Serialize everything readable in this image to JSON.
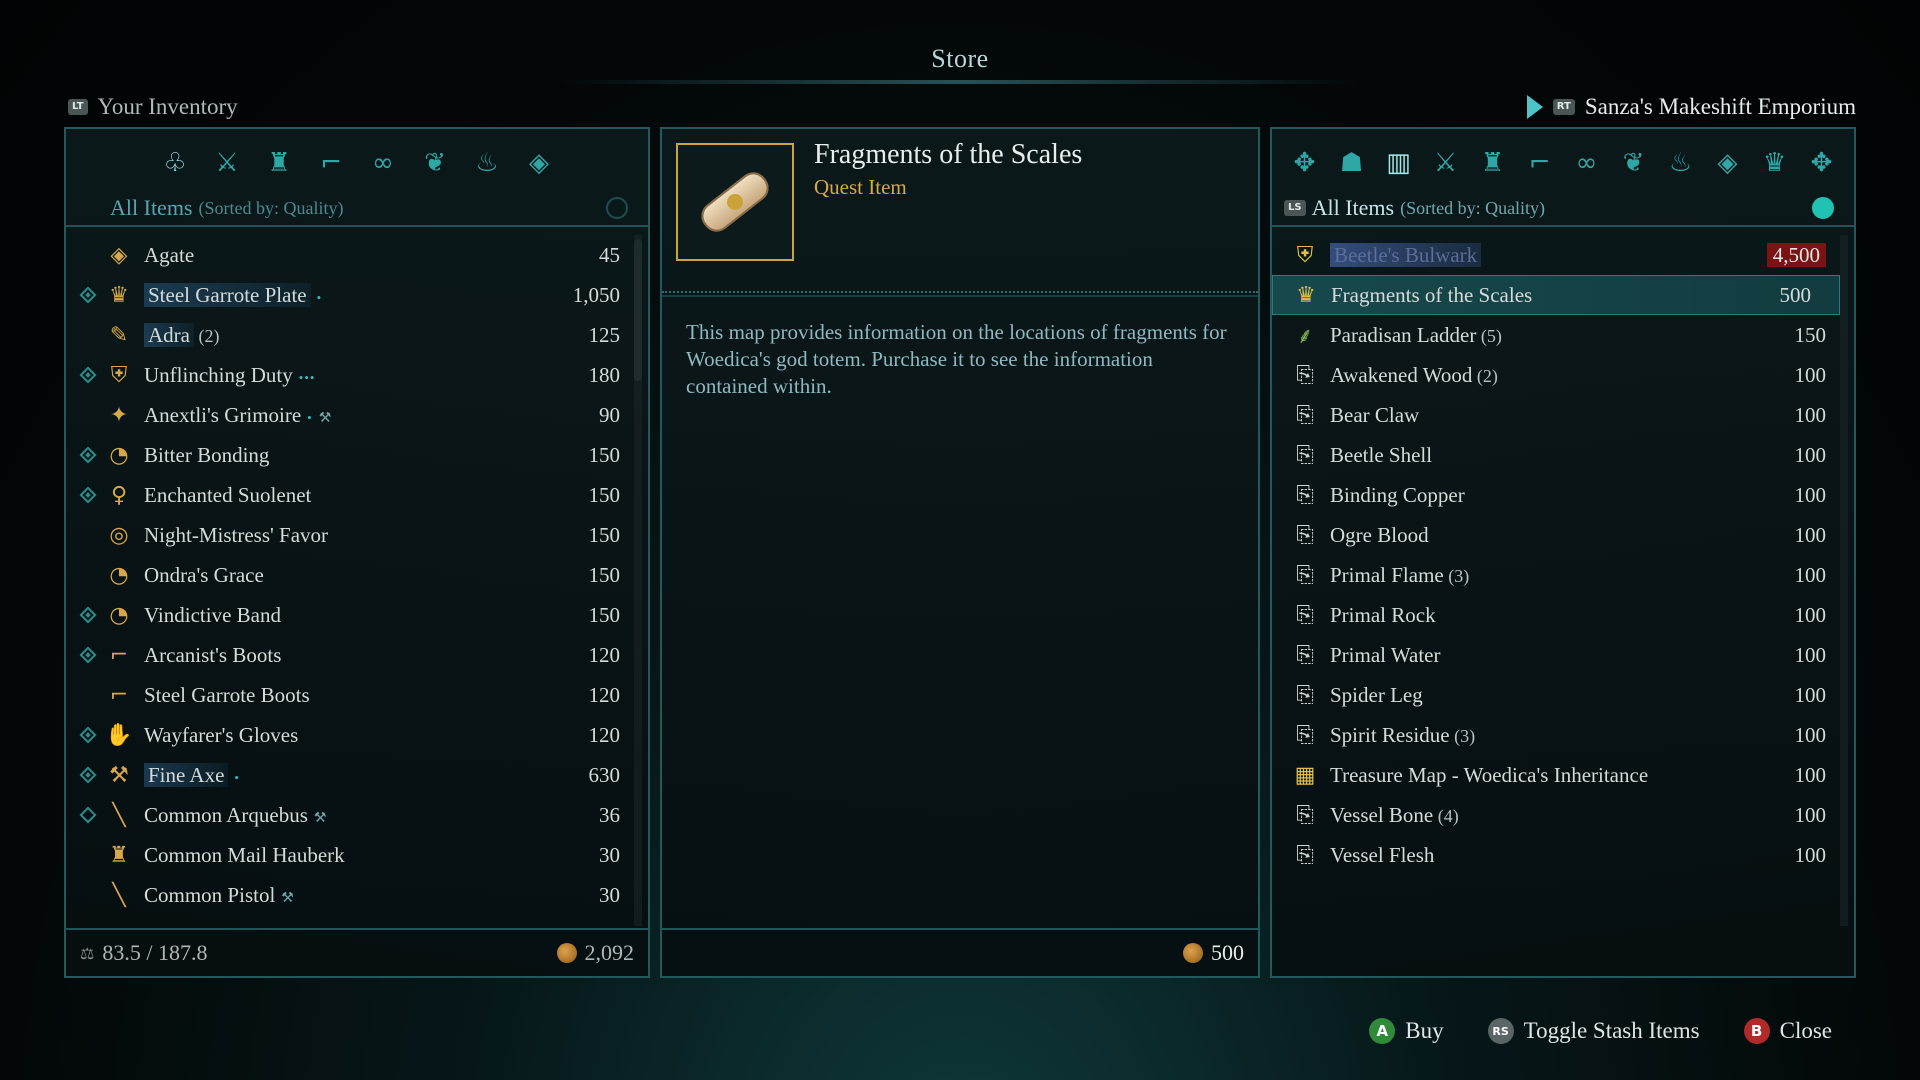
{
  "title": "Store",
  "inventory": {
    "button_hint": "LT",
    "label": "Your Inventory",
    "filter_label": "All Items",
    "filter_sort": "(Sorted by: Quality)",
    "tabs": [
      "pouch-icon",
      "weapons-icon",
      "armor-icon",
      "boots-icon",
      "trinkets-icon",
      "ingredients-icon",
      "lamp-icon",
      "gem-icon"
    ],
    "items": [
      {
        "name": "Agate",
        "count": "",
        "price": "45",
        "pinned": false,
        "icon": "◈"
      },
      {
        "name": "Steel Garrote Plate",
        "count": "",
        "price": "1,050",
        "pinned": true,
        "icon": "♛",
        "ench": "•",
        "highlight": true
      },
      {
        "name": "Adra",
        "count": "(2)",
        "price": "125",
        "pinned": false,
        "icon": "✎",
        "highlight": true
      },
      {
        "name": "Unflinching Duty",
        "count": "",
        "price": "180",
        "pinned": true,
        "icon": "⛨",
        "ench": "•••"
      },
      {
        "name": "Anextli's Grimoire",
        "count": "",
        "price": "90",
        "pinned": false,
        "icon": "✦",
        "ench": "•",
        "tag": "⚒"
      },
      {
        "name": "Bitter Bonding",
        "count": "",
        "price": "150",
        "pinned": true,
        "icon": "◔"
      },
      {
        "name": "Enchanted Suolenet",
        "count": "",
        "price": "150",
        "pinned": true,
        "icon": "♀"
      },
      {
        "name": "Night-Mistress' Favor",
        "count": "",
        "price": "150",
        "pinned": false,
        "icon": "◎"
      },
      {
        "name": "Ondra's Grace",
        "count": "",
        "price": "150",
        "pinned": false,
        "icon": "◔"
      },
      {
        "name": "Vindictive Band",
        "count": "",
        "price": "150",
        "pinned": true,
        "icon": "◔"
      },
      {
        "name": "Arcanist's Boots",
        "count": "",
        "price": "120",
        "pinned": true,
        "icon": "⌐"
      },
      {
        "name": "Steel Garrote Boots",
        "count": "",
        "price": "120",
        "pinned": false,
        "icon": "⌐"
      },
      {
        "name": "Wayfarer's Gloves",
        "count": "",
        "price": "120",
        "pinned": true,
        "icon": "✋"
      },
      {
        "name": "Fine Axe",
        "count": "",
        "price": "630",
        "pinned": true,
        "icon": "⚒",
        "ench": "•",
        "highlight": true
      },
      {
        "name": "Common Arquebus",
        "count": "",
        "price": "36",
        "pinned": true,
        "hollow": true,
        "icon": "╲",
        "tag": "⚒"
      },
      {
        "name": "Common Mail Hauberk",
        "count": "",
        "price": "30",
        "pinned": false,
        "icon": "♜"
      },
      {
        "name": "Common Pistol",
        "count": "",
        "price": "30",
        "pinned": false,
        "icon": "╲",
        "tag": "⚒"
      }
    ],
    "weight": "83.5 / 187.8",
    "gold": "2,092"
  },
  "detail": {
    "name": "Fragments of the Scales",
    "type": "Quest Item",
    "description": "This map provides information on the locations of fragments for Woedica's god totem. Purchase it to see the information contained within.",
    "price": "500"
  },
  "vendor": {
    "button_hint": "RT",
    "label": "Sanza's Makeshift Emporium",
    "filter_hint": "LS",
    "filter_label": "All Items",
    "filter_sort": "(Sorted by: Quality)",
    "tabs": [
      "prev-icon",
      "helmet-icon",
      "chest-icon",
      "weapons-icon",
      "armor-icon",
      "boots-icon",
      "trinkets-icon",
      "ingredients-icon",
      "lamp-icon",
      "gem-icon",
      "crown-icon",
      "next-icon"
    ],
    "items": [
      {
        "name": "Beetle's Bulwark",
        "count": "",
        "price": "4,500",
        "icon": "⛨",
        "state": "unaffordable"
      },
      {
        "name": "Fragments of the Scales",
        "count": "",
        "price": "500",
        "icon": "♛",
        "state": "selected"
      },
      {
        "name": "Paradisan Ladder",
        "count": "(5)",
        "price": "150",
        "icon": "⸙"
      },
      {
        "name": "Awakened Wood",
        "count": "(2)",
        "price": "100",
        "icon": "⎘"
      },
      {
        "name": "Bear Claw",
        "count": "",
        "price": "100",
        "icon": "⎘"
      },
      {
        "name": "Beetle Shell",
        "count": "",
        "price": "100",
        "icon": "⎘"
      },
      {
        "name": "Binding Copper",
        "count": "",
        "price": "100",
        "icon": "⎘"
      },
      {
        "name": "Ogre Blood",
        "count": "",
        "price": "100",
        "icon": "⎘"
      },
      {
        "name": "Primal Flame",
        "count": "(3)",
        "price": "100",
        "icon": "⎘"
      },
      {
        "name": "Primal Rock",
        "count": "",
        "price": "100",
        "icon": "⎘"
      },
      {
        "name": "Primal Water",
        "count": "",
        "price": "100",
        "icon": "⎘"
      },
      {
        "name": "Spider Leg",
        "count": "",
        "price": "100",
        "icon": "⎘"
      },
      {
        "name": "Spirit Residue",
        "count": "(3)",
        "price": "100",
        "icon": "⎘"
      },
      {
        "name": "Treasure Map - Woedica's Inheritance",
        "count": "",
        "price": "100",
        "icon": "▦"
      },
      {
        "name": "Vessel Bone",
        "count": "(4)",
        "price": "100",
        "icon": "⎘"
      },
      {
        "name": "Vessel Flesh",
        "count": "",
        "price": "100",
        "icon": "⎘"
      }
    ]
  },
  "actions": {
    "buy_button": "A",
    "buy_label": "Buy",
    "stash_button": "RS",
    "stash_label": "Toggle Stash Items",
    "close_button": "B",
    "close_label": "Close"
  },
  "colors": {
    "accent": "#2fa7a7",
    "gold": "#d7a84a",
    "border": "#23595c",
    "unaffordable": "#7a1414"
  }
}
